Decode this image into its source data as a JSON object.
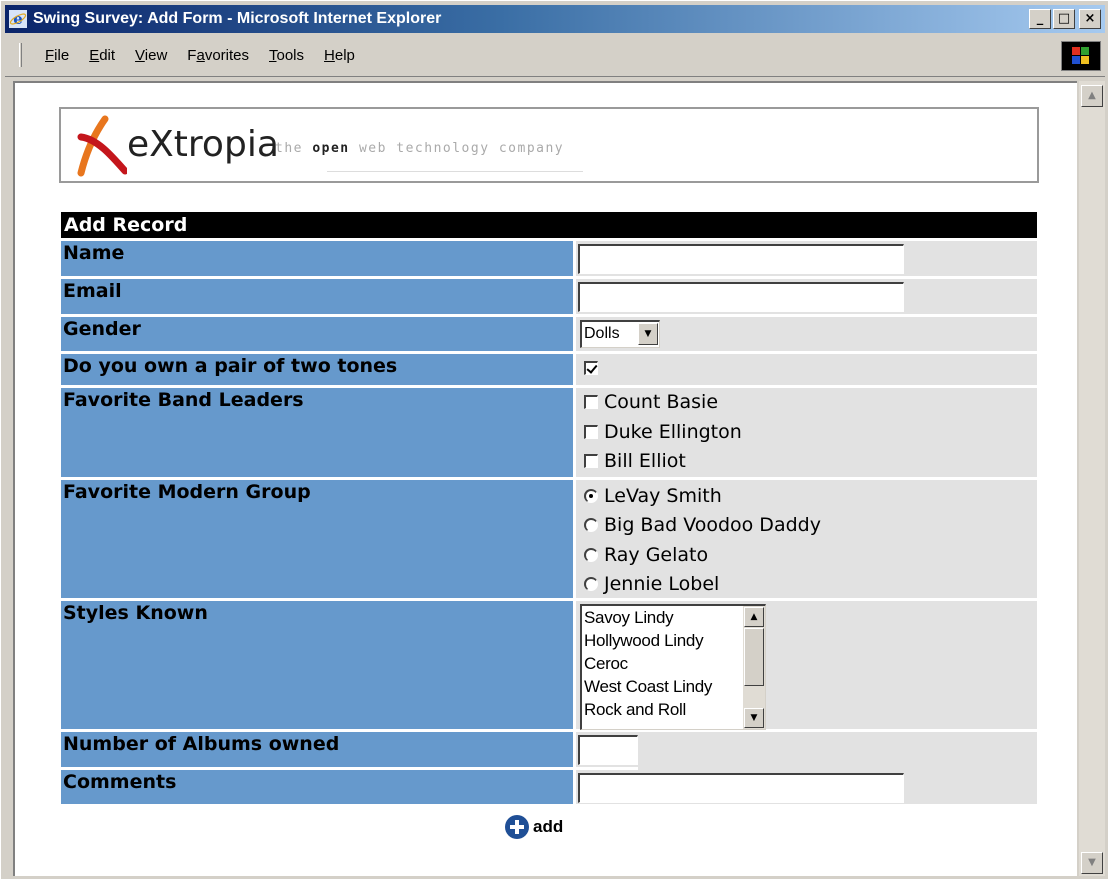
{
  "window": {
    "title": "Swing Survey: Add Form - Microsoft Internet Explorer",
    "minimize_glyph": "_",
    "maximize_glyph": "□",
    "close_glyph": "×"
  },
  "menu": [
    {
      "accel": "F",
      "rest": "ile"
    },
    {
      "accel": "E",
      "rest": "dit"
    },
    {
      "accel": "V",
      "rest": "iew"
    },
    {
      "pre": "F",
      "accel": "a",
      "rest": "vorites"
    },
    {
      "accel": "T",
      "rest": "ools"
    },
    {
      "accel": "H",
      "rest": "elp"
    }
  ],
  "logo": {
    "brand": "eXtropia",
    "tagline_pre": "the ",
    "tagline_strong": "open",
    "tagline_post": " web technology company",
    "colors": {
      "x_orange": "#e8761e",
      "x_red": "#c4161c"
    }
  },
  "form": {
    "header": "Add Record",
    "label_bg": "#6699cc",
    "value_bg": "#e2e2e2",
    "fields": {
      "name": {
        "label": "Name",
        "value": ""
      },
      "email": {
        "label": "Email",
        "value": ""
      },
      "gender": {
        "label": "Gender",
        "selected": "Dolls"
      },
      "two_tones": {
        "label": "Do you own a pair of two tones",
        "checked": true
      },
      "band_leaders": {
        "label": "Favorite Band Leaders",
        "options": [
          "Count Basie",
          "Duke Ellington",
          "Bill Elliot"
        ],
        "checked": [
          false,
          false,
          false
        ]
      },
      "modern_group": {
        "label": "Favorite Modern Group",
        "options": [
          "LeVay Smith",
          "Big Bad Voodoo Daddy",
          "Ray Gelato",
          "Jennie Lobel"
        ],
        "selected_index": 0
      },
      "styles": {
        "label": "Styles Known",
        "options": [
          "Savoy Lindy",
          "Hollywood Lindy",
          "Ceroc",
          "West Coast Lindy",
          "Rock and Roll"
        ]
      },
      "albums": {
        "label": "Number of Albums owned",
        "value": ""
      },
      "comments": {
        "label": "Comments",
        "value": ""
      }
    },
    "submit_label": "add"
  },
  "icons": {
    "browser": "internet-explorer-icon",
    "windows": "windows-logo-icon",
    "submit": "plus-circle-icon",
    "dropdown": "chevron-down-icon"
  }
}
